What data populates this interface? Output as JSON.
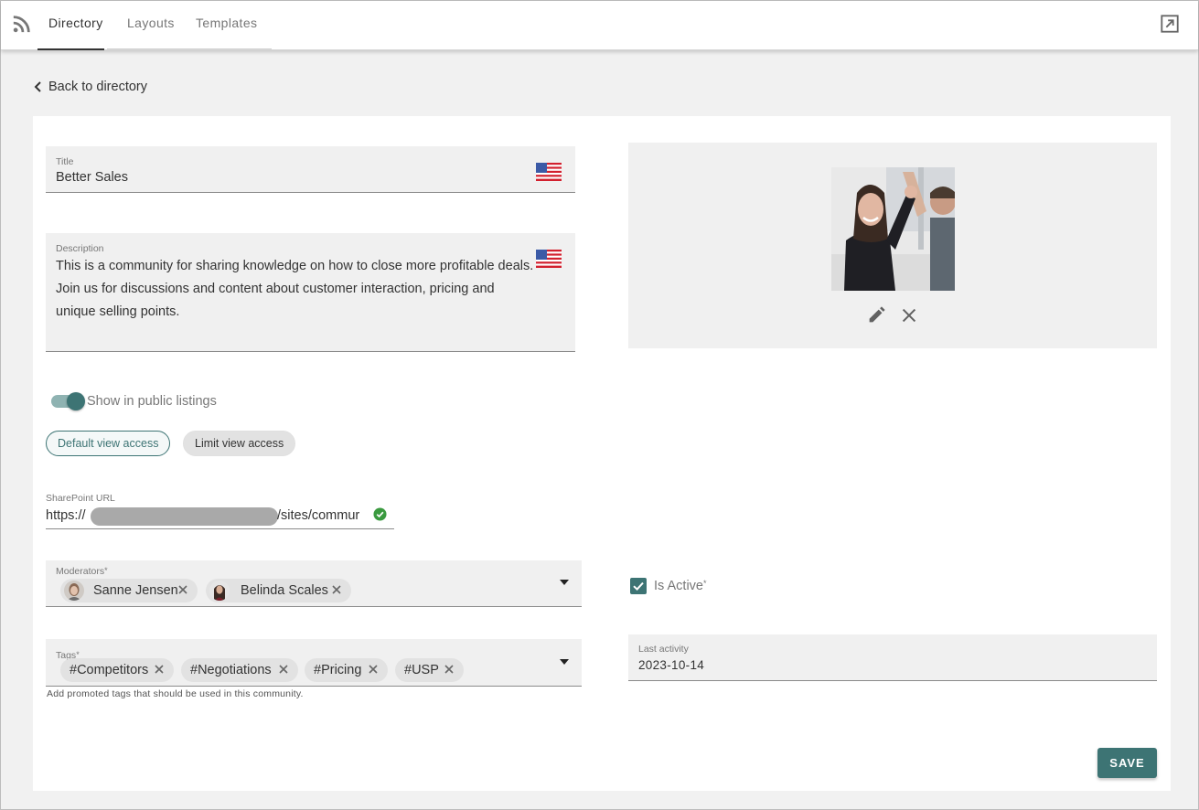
{
  "nav": {
    "tabs": [
      {
        "label": "Directory"
      },
      {
        "label": "Layouts"
      },
      {
        "label": "Templates"
      }
    ]
  },
  "back_link": "Back to directory",
  "form": {
    "title": {
      "label": "Title",
      "value": "Better Sales"
    },
    "description": {
      "label": "Description",
      "value": "This is a community for sharing knowledge on how to close more profitable deals. Join us for discussions and content about customer interaction, pricing and unique selling points."
    },
    "public_listing": {
      "label": "Show in public listings",
      "on": true
    },
    "access_buttons": {
      "default": "Default view access",
      "limit": "Limit view access"
    },
    "sharepoint": {
      "label": "SharePoint URL",
      "prefix": "https://",
      "suffix": "/sites/commur"
    },
    "moderators": {
      "label": "Moderators",
      "required_mark": "*",
      "items": [
        "Sanne Jensen",
        "Belinda Scales"
      ]
    },
    "tags": {
      "label": "Tags",
      "required_mark": "*",
      "items": [
        "#Competitors",
        "#Negotiations",
        "#Pricing",
        "#USP"
      ],
      "helper": "Add promoted tags that should be used in this community."
    },
    "is_active": {
      "label": "Is Active",
      "required_mark": "*",
      "checked": true
    },
    "last_activity": {
      "label": "Last activity",
      "value": "2023-10-14"
    },
    "save_label": "SAVE"
  },
  "colors": {
    "accent": "#3d7474",
    "accent_light": "#8fb3b2",
    "field_bg": "#f0f0f0"
  },
  "icons": [
    "rss-icon",
    "popout-icon",
    "chevron-left-icon",
    "us-flag-icon",
    "edit-icon",
    "close-icon",
    "check-circle-icon",
    "chevron-down-icon",
    "checkbox-check-icon"
  ]
}
